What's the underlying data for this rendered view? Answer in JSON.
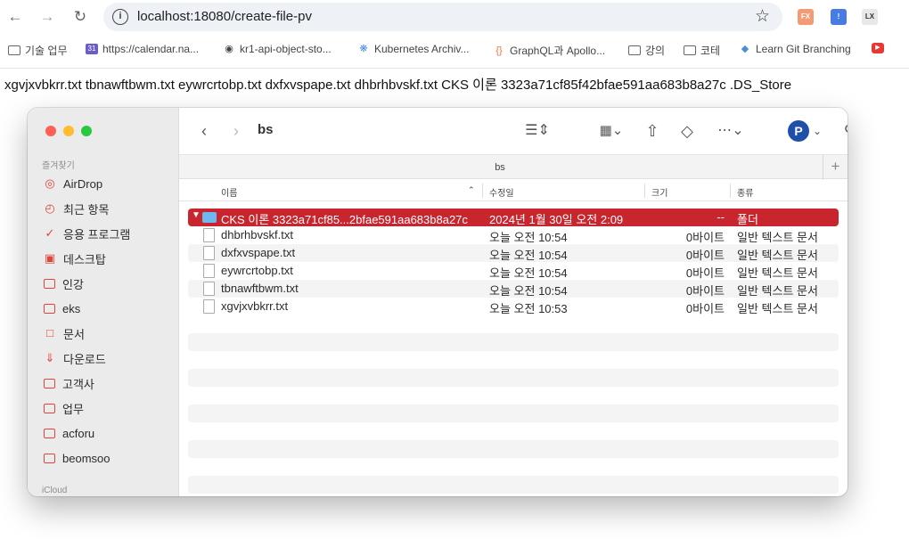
{
  "browser": {
    "url": "localhost:18080/create-file-pv",
    "bookmarks": [
      "기술 업무",
      "https://calendar.na...",
      "kr1-api-object-sto...",
      "Kubernetes Archiv...",
      "GraphQL과 Apollo...",
      "강의",
      "코테",
      "Learn Git Branching"
    ]
  },
  "page": {
    "text": "xgvjxvbkrr.txt tbnawftbwm.txt eywrcrtobp.txt dxfxvspape.txt dhbrhbvskf.txt CKS 이론 3323a71cf85f42bfae591aa683b8a27c .DS_Store"
  },
  "finder": {
    "title": "bs",
    "path_title": "bs",
    "sidebar": {
      "favorites_label": "즐겨찾기",
      "items": [
        "AirDrop",
        "최근 항목",
        "응용 프로그램",
        "데스크탑",
        "인강",
        "eks",
        "문서",
        "다운로드",
        "고객사",
        "업무",
        "acforu",
        "beomsoo"
      ],
      "icloud_label": "iCloud"
    },
    "columns": {
      "name": "이름",
      "date": "수정일",
      "size": "크기",
      "kind": "종류"
    },
    "rows": [
      {
        "name": "CKS 이론 3323a71cf85...2bfae591aa683b8a27c",
        "date": "2024년 1월 30일 오전 2:09",
        "size": "--",
        "kind": "폴더"
      },
      {
        "name": "dhbrhbvskf.txt",
        "date": "오늘 오전 10:54",
        "size": "0바이트",
        "kind": "일반 텍스트 문서"
      },
      {
        "name": "dxfxvspape.txt",
        "date": "오늘 오전 10:54",
        "size": "0바이트",
        "kind": "일반 텍스트 문서"
      },
      {
        "name": "eywrcrtobp.txt",
        "date": "오늘 오전 10:54",
        "size": "0바이트",
        "kind": "일반 텍스트 문서"
      },
      {
        "name": "tbnawftbwm.txt",
        "date": "오늘 오전 10:54",
        "size": "0바이트",
        "kind": "일반 텍스트 문서"
      },
      {
        "name": "xgvjxvbkrr.txt",
        "date": "오늘 오전 10:53",
        "size": "0바이트",
        "kind": "일반 텍스트 문서"
      }
    ]
  },
  "colors": {
    "selection": "#c8252f",
    "sidebar_accent": "#e0453b"
  }
}
